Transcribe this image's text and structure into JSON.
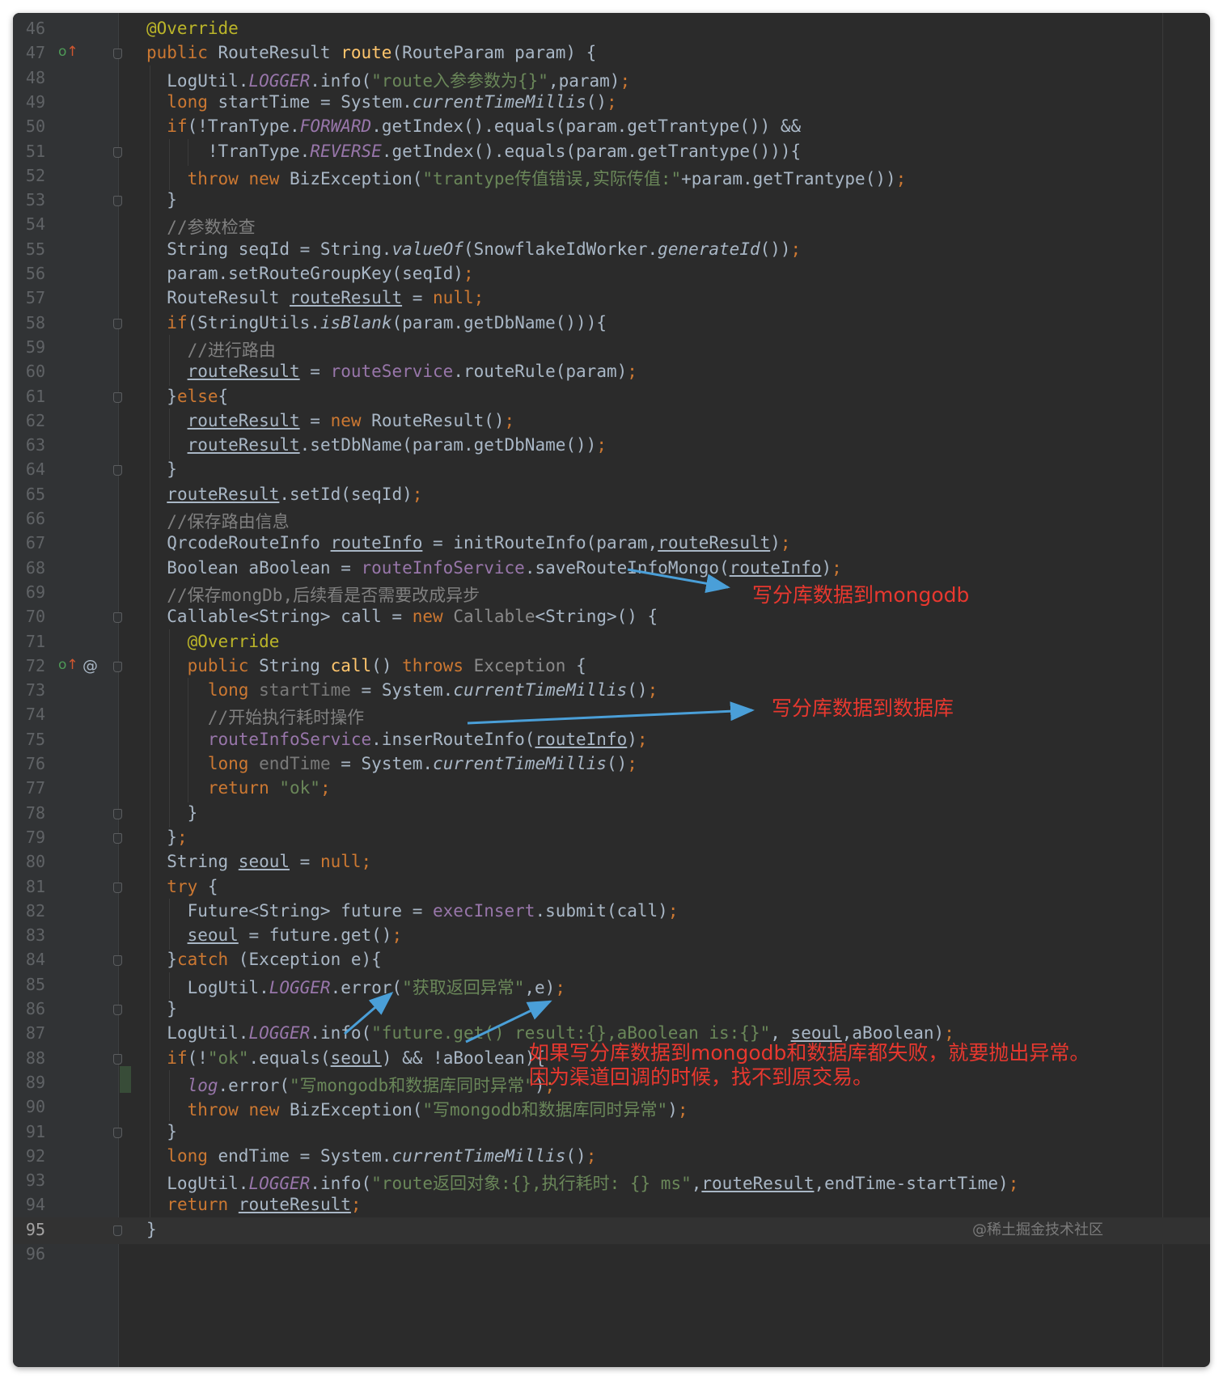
{
  "editor": {
    "lines": [
      {
        "num": "46",
        "icons": [],
        "fold": false,
        "code": "@Override"
      },
      {
        "num": "47",
        "icons": [
          "override"
        ],
        "fold": true,
        "code": "public RouteResult route(RouteParam param) {"
      },
      {
        "num": "48",
        "icons": [],
        "fold": false,
        "code": "  LogUtil.LOGGER.info(\"route入参参数为{}\",param);"
      },
      {
        "num": "49",
        "icons": [],
        "fold": false,
        "code": "  long startTime = System.currentTimeMillis();"
      },
      {
        "num": "50",
        "icons": [],
        "fold": false,
        "code": "  if(!TranType.FORWARD.getIndex().equals(param.getTrantype()) &&"
      },
      {
        "num": "51",
        "icons": [],
        "fold": true,
        "code": "      !TranType.REVERSE.getIndex().equals(param.getTrantype())){"
      },
      {
        "num": "52",
        "icons": [],
        "fold": false,
        "code": "    throw new BizException(\"trantype传值错误,实际传值:\"+param.getTrantype());"
      },
      {
        "num": "53",
        "icons": [],
        "fold": true,
        "code": "  }"
      },
      {
        "num": "54",
        "icons": [],
        "fold": false,
        "code": "  //参数检查"
      },
      {
        "num": "55",
        "icons": [],
        "fold": false,
        "code": "  String seqId = String.valueOf(SnowflakeIdWorker.generateId());"
      },
      {
        "num": "56",
        "icons": [],
        "fold": false,
        "code": "  param.setRouteGroupKey(seqId);"
      },
      {
        "num": "57",
        "icons": [],
        "fold": false,
        "code": "  RouteResult routeResult = null;"
      },
      {
        "num": "58",
        "icons": [],
        "fold": true,
        "code": "  if(StringUtils.isBlank(param.getDbName())){"
      },
      {
        "num": "59",
        "icons": [],
        "fold": false,
        "code": "    //进行路由"
      },
      {
        "num": "60",
        "icons": [],
        "fold": false,
        "code": "    routeResult = routeService.routeRule(param);"
      },
      {
        "num": "61",
        "icons": [],
        "fold": true,
        "code": "  }else{"
      },
      {
        "num": "62",
        "icons": [],
        "fold": false,
        "code": "    routeResult = new RouteResult();"
      },
      {
        "num": "63",
        "icons": [],
        "fold": false,
        "code": "    routeResult.setDbName(param.getDbName());"
      },
      {
        "num": "64",
        "icons": [],
        "fold": true,
        "code": "  }"
      },
      {
        "num": "65",
        "icons": [],
        "fold": false,
        "code": "  routeResult.setId(seqId);"
      },
      {
        "num": "66",
        "icons": [],
        "fold": false,
        "code": "  //保存路由信息"
      },
      {
        "num": "67",
        "icons": [],
        "fold": false,
        "code": "  QrcodeRouteInfo routeInfo = initRouteInfo(param,routeResult);"
      },
      {
        "num": "68",
        "icons": [],
        "fold": false,
        "code": "  Boolean aBoolean = routeInfoService.saveRouteInfoMongo(routeInfo);"
      },
      {
        "num": "69",
        "icons": [],
        "fold": false,
        "code": "  //保存mongDb,后续看是否需要改成异步"
      },
      {
        "num": "70",
        "icons": [],
        "fold": true,
        "code": "  Callable<String> call = new Callable<String>() {"
      },
      {
        "num": "71",
        "icons": [],
        "fold": false,
        "code": "    @Override"
      },
      {
        "num": "72",
        "icons": [
          "override",
          "at"
        ],
        "fold": true,
        "code": "    public String call() throws Exception {"
      },
      {
        "num": "73",
        "icons": [],
        "fold": false,
        "code": "      long startTime = System.currentTimeMillis();"
      },
      {
        "num": "74",
        "icons": [],
        "fold": false,
        "code": "      //开始执行耗时操作"
      },
      {
        "num": "75",
        "icons": [],
        "fold": false,
        "code": "      routeInfoService.inserRouteInfo(routeInfo);"
      },
      {
        "num": "76",
        "icons": [],
        "fold": false,
        "code": "      long endTime = System.currentTimeMillis();"
      },
      {
        "num": "77",
        "icons": [],
        "fold": false,
        "code": "      return \"ok\";"
      },
      {
        "num": "78",
        "icons": [],
        "fold": true,
        "code": "    }"
      },
      {
        "num": "79",
        "icons": [],
        "fold": true,
        "code": "  };"
      },
      {
        "num": "80",
        "icons": [],
        "fold": false,
        "code": "  String seoul = null;"
      },
      {
        "num": "81",
        "icons": [],
        "fold": true,
        "code": "  try {"
      },
      {
        "num": "82",
        "icons": [],
        "fold": false,
        "code": "    Future<String> future = execInsert.submit(call);"
      },
      {
        "num": "83",
        "icons": [],
        "fold": false,
        "code": "    seoul = future.get();"
      },
      {
        "num": "84",
        "icons": [],
        "fold": true,
        "code": "  }catch (Exception e){"
      },
      {
        "num": "85",
        "icons": [],
        "fold": false,
        "code": "    LogUtil.LOGGER.error(\"获取返回异常\",e);"
      },
      {
        "num": "86",
        "icons": [],
        "fold": true,
        "code": "  }"
      },
      {
        "num": "87",
        "icons": [],
        "fold": false,
        "code": "  LogUtil.LOGGER.info(\"future.get() result:{},aBoolean is:{}\", seoul,aBoolean);"
      },
      {
        "num": "88",
        "icons": [],
        "fold": true,
        "code": "  if(!\"ok\".equals(seoul) && !aBoolean){"
      },
      {
        "num": "89",
        "icons": [],
        "fold": false,
        "code": "    log.error(\"写mongodb和数据库同时异常\");"
      },
      {
        "num": "90",
        "icons": [],
        "fold": false,
        "code": "    throw new BizException(\"写mongodb和数据库同时异常\");"
      },
      {
        "num": "91",
        "icons": [],
        "fold": true,
        "code": "  }"
      },
      {
        "num": "92",
        "icons": [],
        "fold": false,
        "code": "  long endTime = System.currentTimeMillis();"
      },
      {
        "num": "93",
        "icons": [],
        "fold": false,
        "code": "  LogUtil.LOGGER.info(\"route返回对象:{},执行耗时: {} ms\",routeResult,endTime-startTime);"
      },
      {
        "num": "94",
        "icons": [],
        "fold": false,
        "code": "  return routeResult;"
      },
      {
        "num": "95",
        "icons": [],
        "fold": true,
        "code": "}"
      },
      {
        "num": "96",
        "icons": [],
        "fold": false,
        "code": ""
      }
    ]
  },
  "annotations": {
    "mongodb_note": "写分库数据到mongodb",
    "db_note": "写分库数据到数据库",
    "failure_note_1": "如果写分库数据到mongodb和数据库都失败，就要抛出异常。",
    "failure_note_2": "因为渠道回调的时候，找不到原交易。"
  },
  "watermark": "@稀土掘金技术社区",
  "icons": {
    "override": "override-up-arrow-icon",
    "at": "at-sign-icon"
  },
  "colors": {
    "background": "#2b2b2b",
    "keyword": "#cc7832",
    "string": "#6a8759",
    "comment": "#808080",
    "field": "#9876aa",
    "method": "#ffc66d",
    "annotation": "#bbb529",
    "annotation_note": "#e8382f",
    "arrow": "#4a9fd8"
  }
}
